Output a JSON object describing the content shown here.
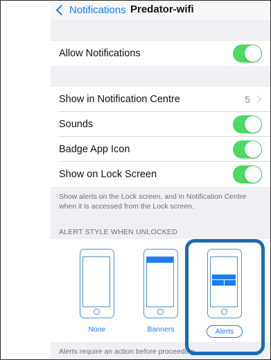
{
  "nav": {
    "back_label": "Notifications",
    "title": "Predator-wifi"
  },
  "rows": {
    "allow_notifications": {
      "label": "Allow Notifications",
      "on": true
    },
    "notification_centre": {
      "label": "Show in Notification Centre",
      "value": "5"
    },
    "sounds": {
      "label": "Sounds",
      "on": true
    },
    "badge_app_icon": {
      "label": "Badge App Icon",
      "on": true
    },
    "lock_screen": {
      "label": "Show on Lock Screen",
      "on": true
    }
  },
  "footnote": "Show alerts on the Lock screen, and in Notification Centre when it is accessed from the Lock screen.",
  "alert_style": {
    "header": "ALERT STYLE WHEN UNLOCKED",
    "options": [
      {
        "label": "None"
      },
      {
        "label": "Banners"
      },
      {
        "label": "Alerts"
      }
    ],
    "selected": "Alerts"
  },
  "bottom_note": "Alerts require an action before proceeding.",
  "colors": {
    "accent": "#1a7df2",
    "toggle_on": "#4cd964",
    "highlight": "#1d6ab4"
  }
}
